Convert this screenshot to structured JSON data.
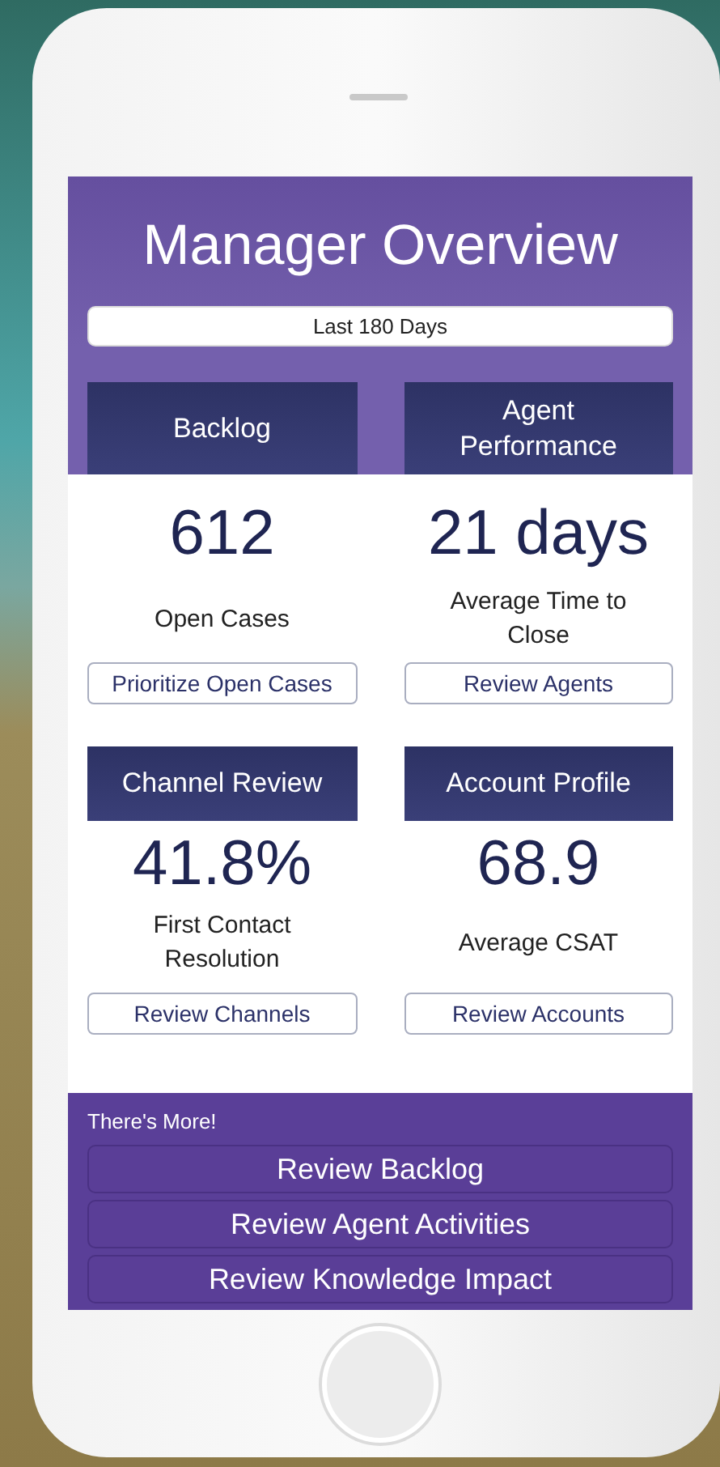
{
  "header": {
    "title": "Manager Overview",
    "date_filter": "Last 180 Days"
  },
  "card_rows": [
    {
      "cards": [
        {
          "title": "Backlog",
          "value": "612",
          "caption": "Open Cases",
          "button": "Prioritize Open Cases"
        },
        {
          "title": "Agent Performance",
          "value": "21 days",
          "caption": "Average Time to Close",
          "button": "Review Agents"
        }
      ]
    },
    {
      "cards": [
        {
          "title": "Channel Review",
          "value": "41.8%",
          "caption": "First Contact Resolution",
          "button": "Review Channels"
        },
        {
          "title": "Account Profile",
          "value": "68.9",
          "caption": "Average CSAT",
          "button": "Review Accounts"
        }
      ]
    }
  ],
  "more": {
    "label": "There's More!",
    "buttons": [
      "Review Backlog",
      "Review Agent Activities",
      "Review Knowledge Impact"
    ]
  }
}
